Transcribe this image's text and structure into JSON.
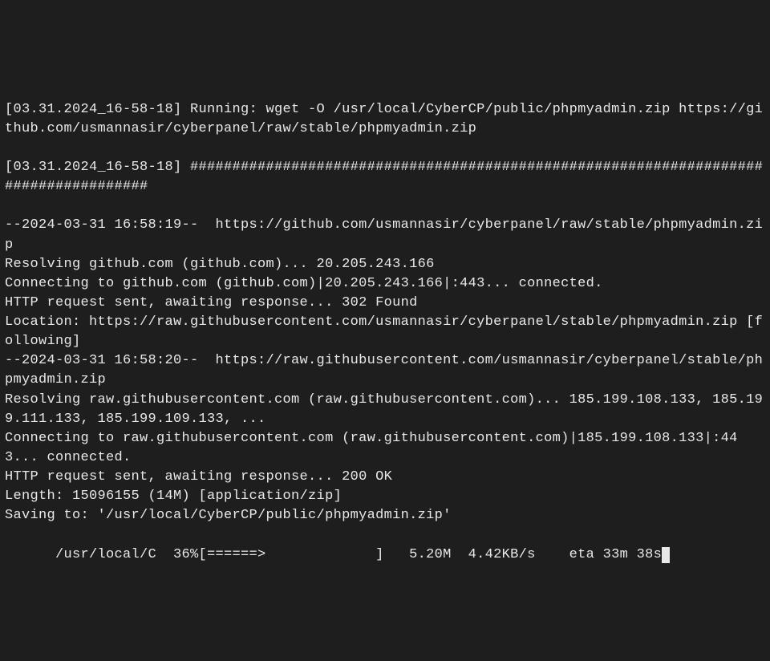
{
  "terminal": {
    "line1": "[03.31.2024_16-58-18] Running: wget -O /usr/local/CyberCP/public/phpmyadmin.zip https://github.com/usmannasir/cyberpanel/raw/stable/phpmyadmin.zip",
    "line2": "",
    "line3": "[03.31.2024_16-58-18] #####################################################################################",
    "line4": "",
    "line5": "--2024-03-31 16:58:19--  https://github.com/usmannasir/cyberpanel/raw/stable/phpmyadmin.zip",
    "line6": "Resolving github.com (github.com)... 20.205.243.166",
    "line7": "Connecting to github.com (github.com)|20.205.243.166|:443... connected.",
    "line8": "HTTP request sent, awaiting response... 302 Found",
    "line9": "Location: https://raw.githubusercontent.com/usmannasir/cyberpanel/stable/phpmyadmin.zip [following]",
    "line10": "--2024-03-31 16:58:20--  https://raw.githubusercontent.com/usmannasir/cyberpanel/stable/phpmyadmin.zip",
    "line11": "Resolving raw.githubusercontent.com (raw.githubusercontent.com)... 185.199.108.133, 185.199.111.133, 185.199.109.133, ...",
    "line12": "Connecting to raw.githubusercontent.com (raw.githubusercontent.com)|185.199.108.133|:443... connected.",
    "line13": "HTTP request sent, awaiting response... 200 OK",
    "line14": "Length: 15096155 (14M) [application/zip]",
    "line15": "Saving to: '/usr/local/CyberCP/public/phpmyadmin.zip'",
    "line16": "",
    "progress": {
      "filename": "      /usr/local/C",
      "percent": "  36%",
      "bar": "[======>             ]",
      "size": "   5.20M",
      "speed": "  4.42KB/s",
      "eta": "    eta 33m 38s"
    }
  }
}
